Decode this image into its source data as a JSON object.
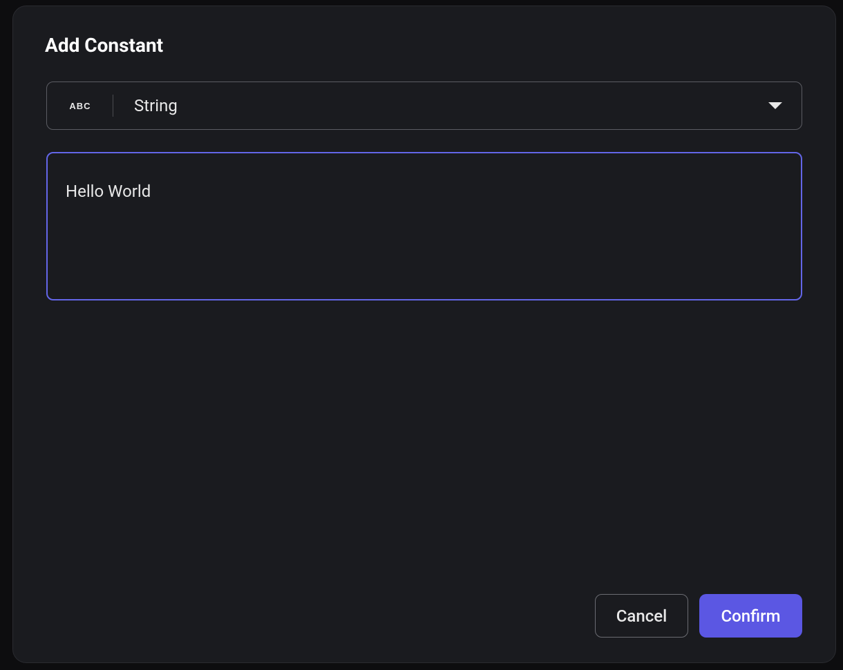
{
  "dialog": {
    "title": "Add Constant",
    "typeSelector": {
      "iconText": "ABC",
      "selectedLabel": "String"
    },
    "valueInput": {
      "value": "Hello World"
    },
    "buttons": {
      "cancel": "Cancel",
      "confirm": "Confirm"
    }
  },
  "colors": {
    "accent": "#6366e8",
    "primary": "#5b57e3",
    "background": "#1a1b1f",
    "border": "#5c5d63"
  }
}
